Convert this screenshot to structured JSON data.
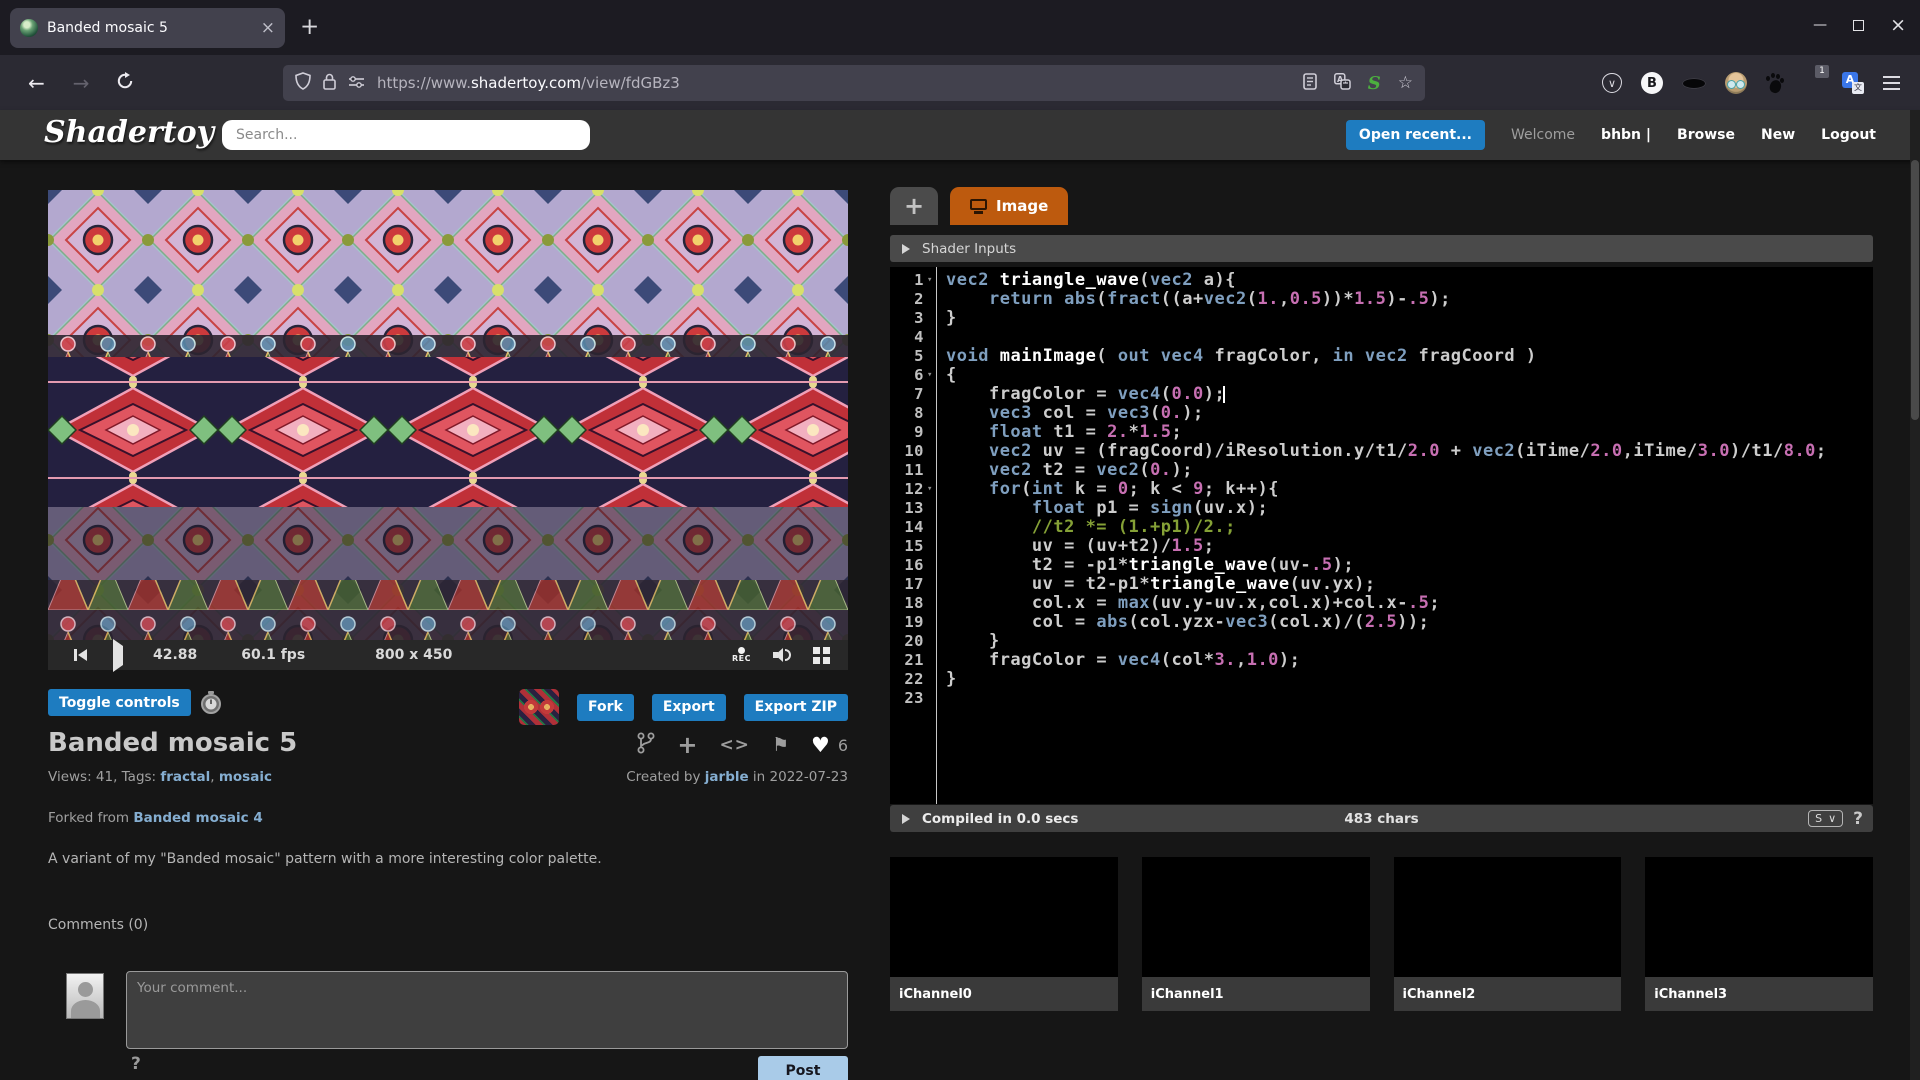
{
  "browser": {
    "tab_title": "Banded mosaic 5",
    "url_prefix": "https://www.",
    "url_domain": "shadertoy.com",
    "url_path": "/view/fdGBz3",
    "adblock_badge": "1",
    "icons": {
      "close_tab": "×",
      "new_tab": "+",
      "back": "←",
      "forward": "→",
      "minimize": "—",
      "close_window": "×",
      "star": "☆",
      "pocket_check": "∨",
      "bitwarden_letter": "B",
      "stylus_letter": "S",
      "translate_letter": "A",
      "translate_glyph": "文"
    }
  },
  "header": {
    "logo": "Shadertoy",
    "search_placeholder": "Search...",
    "open_recent": "Open recent...",
    "welcome": "Welcome",
    "username": "bhbn",
    "separator": "|",
    "nav": [
      "Browse",
      "New",
      "Logout"
    ]
  },
  "player": {
    "time": "42.88",
    "fps": "60.1 fps",
    "resolution": "800 x 450",
    "rec_label": "REC"
  },
  "actions": {
    "toggle_controls": "Toggle controls",
    "fork": "Fork",
    "export": "Export",
    "export_zip": "Export ZIP"
  },
  "shader": {
    "title": "Banded mosaic 5",
    "meta_prefix": "Views: 41, Tags: ",
    "tag1": "fractal",
    "tag_sep": ", ",
    "tag2": "mosaic",
    "created_prefix": "Created by ",
    "author": "jarble",
    "created_suffix": " in 2022-07-23",
    "forked_prefix": "Forked from ",
    "forked_from": "Banded mosaic 4",
    "description": "A variant of my \"Banded mosaic\" pattern with a more interesting color palette.",
    "comments_heading": "Comments (0)",
    "comment_placeholder": "Your comment...",
    "comment_help": "?",
    "post_label": "Post",
    "likes": "6",
    "title_icons": {
      "code": "<>",
      "plus": "+",
      "flag": "⚑",
      "heart": "♥"
    }
  },
  "editor": {
    "tab_plus": "+",
    "tab_image": "Image",
    "shader_inputs_label": "Shader Inputs",
    "compile_status": "Compiled in 0.0 secs",
    "char_count": "483 chars",
    "size_select": "S",
    "size_caret": "∨",
    "help": "?",
    "fold_lines": [
      1,
      6,
      12
    ],
    "cursor_line": 7,
    "cursor_col": 25,
    "code": [
      "vec2 triangle_wave(vec2 a){",
      "    return abs(fract((a+vec2(1.,0.5))*1.5)-.5);",
      "}",
      "",
      "void mainImage( out vec4 fragColor, in vec2 fragCoord )",
      "{",
      "    fragColor = vec4(0.0);",
      "    vec3 col = vec3(0.);",
      "    float t1 = 2.*1.5;",
      "    vec2 uv = (fragCoord)/iResolution.y/t1/2.0 + vec2(iTime/2.0,iTime/3.0)/t1/8.0;",
      "    vec2 t2 = vec2(0.);",
      "    for(int k = 0; k < 9; k++){",
      "        float p1 = sign(uv.x);",
      "        //t2 *= (1.+p1)/2.;",
      "        uv = (uv+t2)/1.5;",
      "        t2 = -p1*triangle_wave(uv-.5);",
      "        uv = t2-p1*triangle_wave(uv.yx);",
      "        col.x = max(uv.y-uv.x,col.x)+col.x-.5;",
      "        col = abs(col.yzx-vec3(col.x)/(2.5));",
      "    }",
      "    fragColor = vec4(col*3.,1.0);",
      "}",
      ""
    ]
  },
  "channels": [
    "iChannel0",
    "iChannel1",
    "iChannel2",
    "iChannel3"
  ],
  "colors": {
    "accent_blue": "#1e7cc0",
    "link_blue": "#85aed1",
    "tab_orange": "#bd5a0e",
    "post_button": "#a9cbe8",
    "syntax_keyword": "#7f9fbf",
    "syntax_number": "#c76fb2",
    "syntax_comment": "#85a136",
    "code_text": "#cdcdcd"
  }
}
